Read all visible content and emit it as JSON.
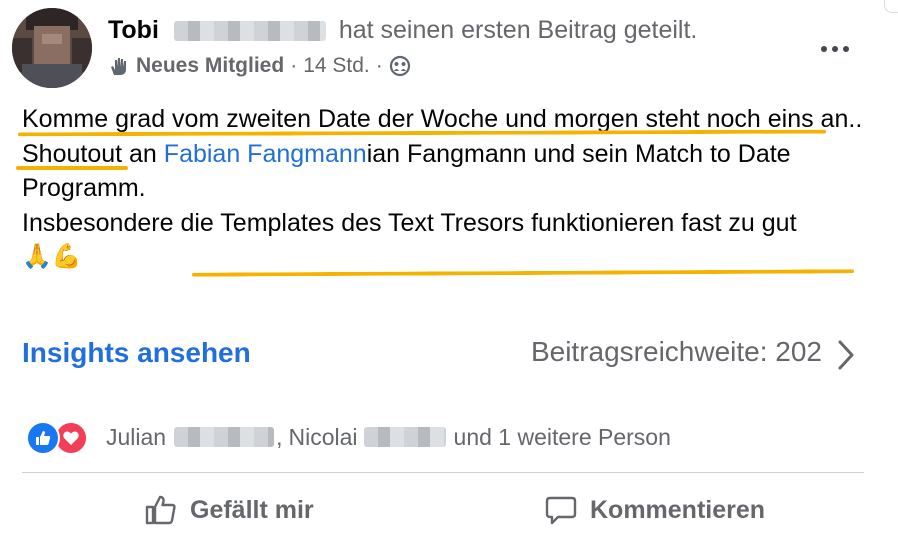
{
  "post": {
    "author_name": "Tobi",
    "author_action": "hat seinen ersten Beitrag geteilt.",
    "badge": "Neues Mitglied",
    "meta_separator": "·",
    "time": "14 Std.",
    "meta_separator2": "·",
    "audience_icon": "group-audience-icon",
    "more_icon": "more-horizontal-icon"
  },
  "body": {
    "line1": "Komme grad vom zweiten Date der Woche und morgen steht noch eins an..",
    "line2_prefix": "Shoutout an ",
    "line2_mention": "Fabian Fangmann",
    "line2_suffix": "ian Fangmann und sein Match to Date Programm.",
    "line3": "Insbesondere die Templates des Text Tresors funktionieren fast zu gut",
    "emoji": "🙏💪",
    "highlight_color": "#f3b300"
  },
  "insights": {
    "link_label": "Insights ansehen",
    "reach_label": "Beitragsreichweite: 202",
    "chevron_icon": "chevron-right-icon"
  },
  "reactions": {
    "icons": [
      "like-reaction-icon",
      "love-reaction-icon"
    ],
    "name1": "Julian",
    "separator": ",",
    "name2": "Nicolai",
    "others": "und 1 weitere Person"
  },
  "actions": {
    "like_label": "Gefällt mir",
    "comment_label": "Kommentieren"
  },
  "colors": {
    "link": "#216fdb",
    "secondary_text": "#65676b",
    "like_blue": "#1877f2",
    "love_red": "#f33e58"
  }
}
